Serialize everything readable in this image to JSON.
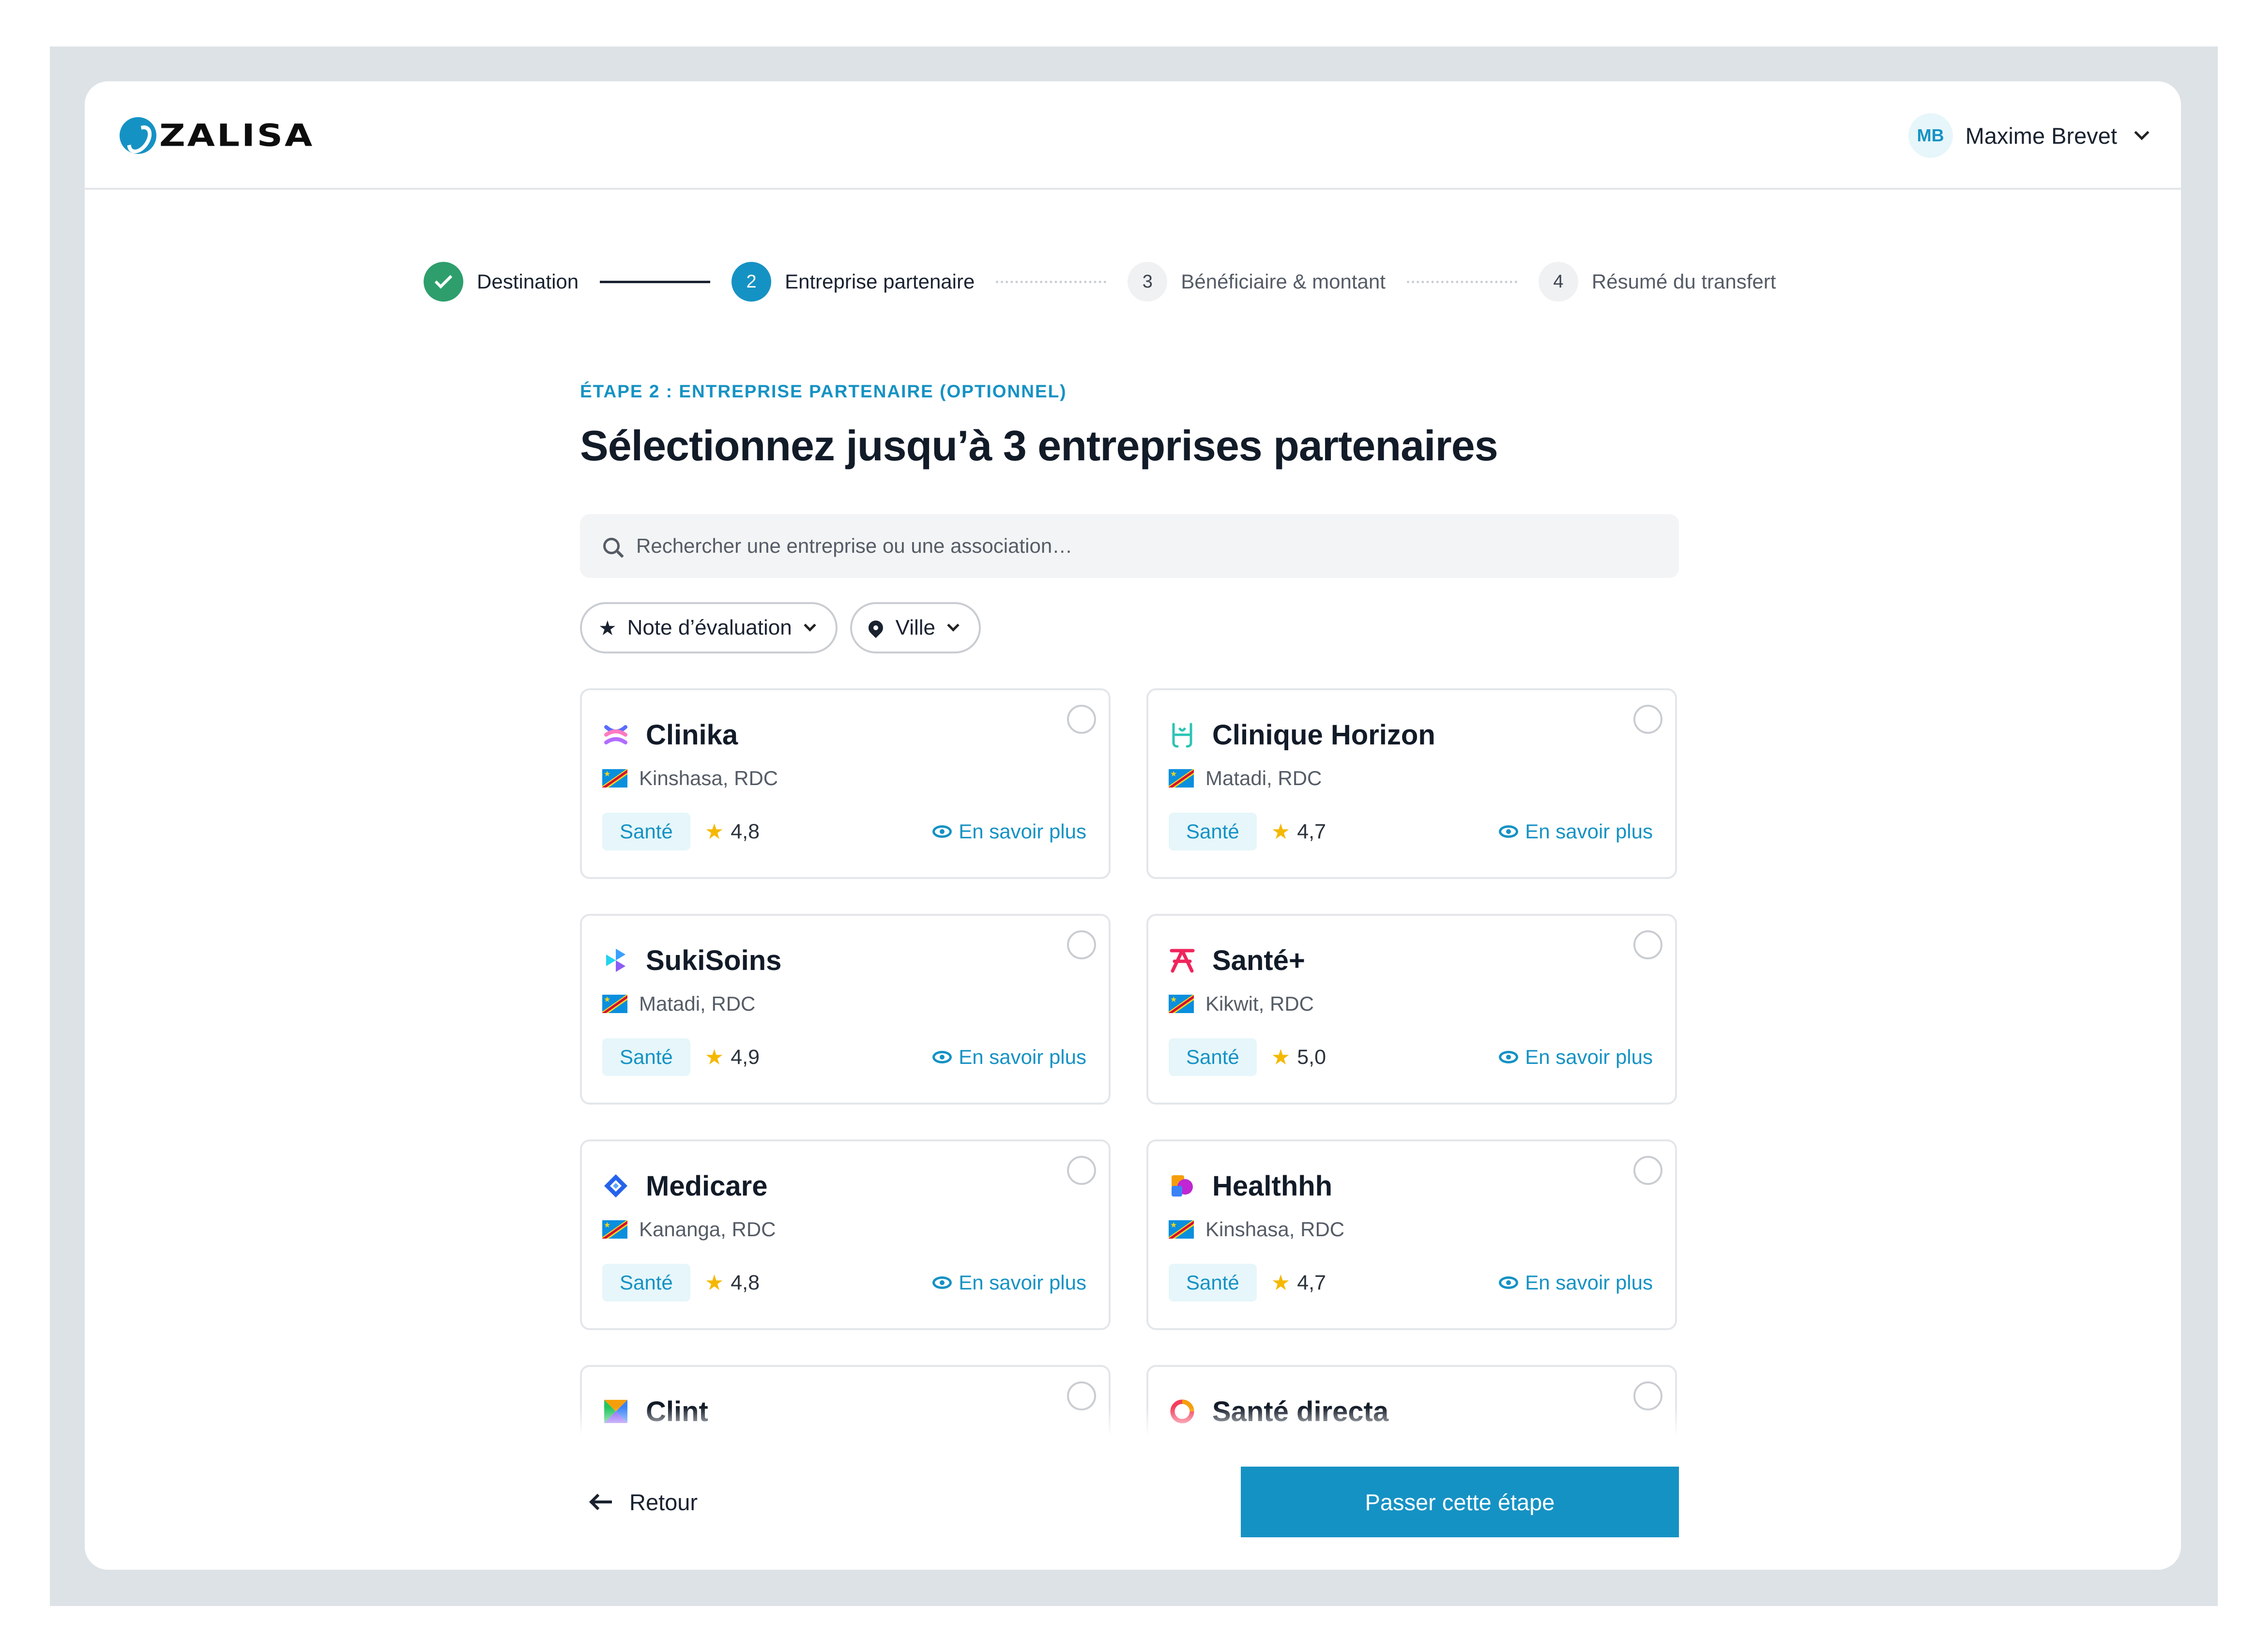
{
  "app": {
    "logo_text": "ZALISA"
  },
  "colors": {
    "accent": "#1592c4",
    "success": "#2e9e6c",
    "star": "#f5b800"
  },
  "user": {
    "initials": "MB",
    "name": "Maxime Brevet"
  },
  "stepper": {
    "steps": [
      {
        "number": "1",
        "label": "Destination",
        "state": "done"
      },
      {
        "number": "2",
        "label": "Entreprise partenaire",
        "state": "active"
      },
      {
        "number": "3",
        "label": "Bénéficiaire & montant",
        "state": "todo"
      },
      {
        "number": "4",
        "label": "Résumé du transfert",
        "state": "todo"
      }
    ]
  },
  "main": {
    "eyebrow": "ÉTAPE 2 : ENTREPRISE PARTENAIRE (OPTIONNEL)",
    "title": "Sélectionnez jusqu’à 3 entreprises partenaires",
    "search_placeholder": "Rechercher une entreprise ou une association…",
    "filters": {
      "rating": "Note d’évaluation",
      "city": "Ville"
    }
  },
  "companies": [
    {
      "name": "Clinika",
      "location": "Kinshasa, RDC",
      "category": "Santé",
      "rating": "4,8",
      "more": "En savoir plus",
      "logo": "clinika-logo"
    },
    {
      "name": "Clinique Horizon",
      "location": "Matadi, RDC",
      "category": "Santé",
      "rating": "4,7",
      "more": "En savoir plus",
      "logo": "clinique-horizon-logo"
    },
    {
      "name": "SukiSoins",
      "location": "Matadi, RDC",
      "category": "Santé",
      "rating": "4,9",
      "more": "En savoir plus",
      "logo": "sukisoins-logo"
    },
    {
      "name": "Santé+",
      "location": "Kikwit, RDC",
      "category": "Santé",
      "rating": "5,0",
      "more": "En savoir plus",
      "logo": "sante-plus-logo"
    },
    {
      "name": "Medicare",
      "location": "Kananga, RDC",
      "category": "Santé",
      "rating": "4,8",
      "more": "En savoir plus",
      "logo": "medicare-logo"
    },
    {
      "name": "Healthhh",
      "location": "Kinshasa, RDC",
      "category": "Santé",
      "rating": "4,7",
      "more": "En savoir plus",
      "logo": "healthhh-logo"
    },
    {
      "name": "Clint",
      "location": "",
      "category": "",
      "rating": "",
      "more": "",
      "logo": "clint-logo"
    },
    {
      "name": "Santé directa",
      "location": "",
      "category": "",
      "rating": "",
      "more": "",
      "logo": "sante-directa-logo"
    }
  ],
  "footer": {
    "back": "Retour",
    "skip": "Passer cette étape"
  }
}
